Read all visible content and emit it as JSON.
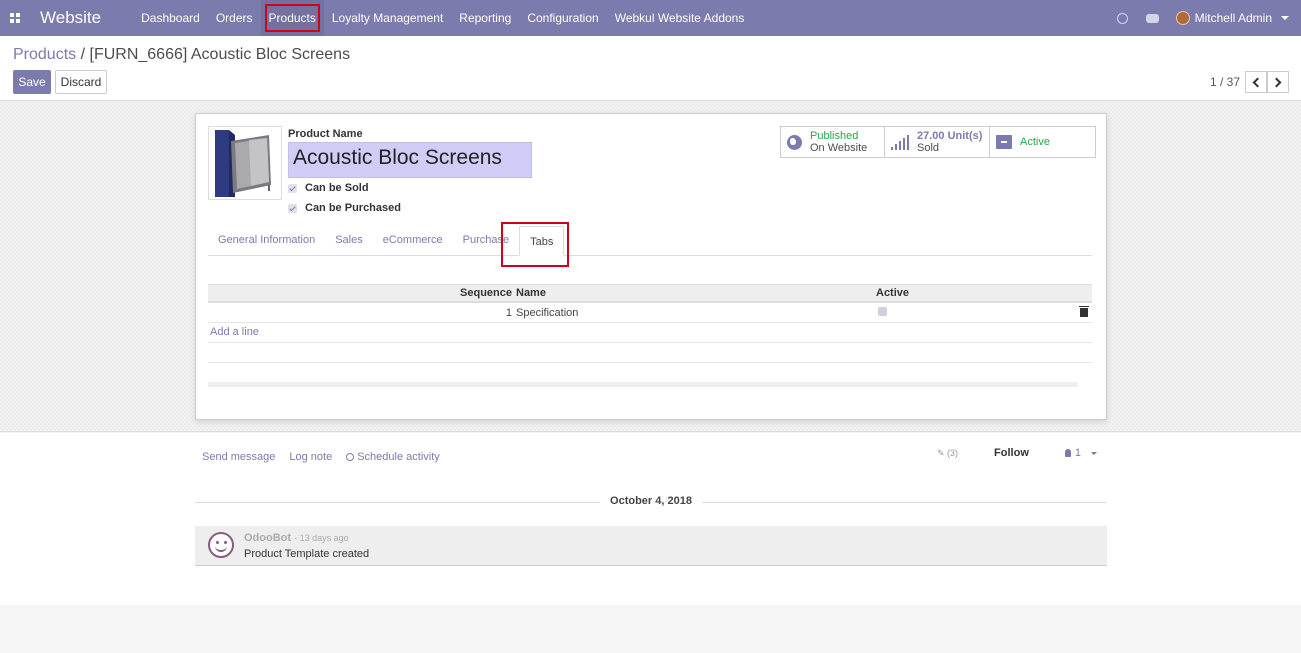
{
  "navbar": {
    "brand": "Website",
    "menu": [
      "Dashboard",
      "Orders",
      "Products",
      "Loyalty Management",
      "Reporting",
      "Configuration",
      "Webkul Website Addons"
    ],
    "highlighted_item": "Products",
    "user_name": "Mitchell Admin",
    "bg_color": "#7c7bad"
  },
  "control_panel": {
    "breadcrumb_root": "Products",
    "breadcrumb_separator": "/",
    "breadcrumb_current": "[FURN_6666] Acoustic Bloc Screens",
    "save_label": "Save",
    "discard_label": "Discard",
    "pager_value": "1 / 37"
  },
  "product": {
    "name_label": "Product Name",
    "name_value": "Acoustic Bloc Screens",
    "can_be_sold_label": "Can be Sold",
    "can_be_purchased_label": "Can be Purchased"
  },
  "stat_buttons": {
    "website_line1": "Published",
    "website_line2": "On Website",
    "sold_value": "27.00 Unit(s)",
    "sold_label": "Sold",
    "active_label": "Active"
  },
  "tabs": {
    "items": [
      "General Information",
      "Sales",
      "eCommerce",
      "Purchase",
      "Tabs"
    ],
    "active": "Tabs"
  },
  "tabs_table": {
    "headers": [
      "Sequence",
      "Name",
      "Active"
    ],
    "rows": [
      {
        "sequence": "1",
        "name": "Specification",
        "active": true
      }
    ],
    "add_line_label": "Add a line"
  },
  "chatter": {
    "send_message": "Send message",
    "log_note": "Log note",
    "schedule_activity": "Schedule activity",
    "attachments": "(3)",
    "follow_label": "Follow",
    "followers_count": "1",
    "date_separator": "October 4, 2018",
    "message": {
      "author": "OdooBot",
      "time": "- 13 days ago",
      "body": "Product Template created"
    }
  }
}
